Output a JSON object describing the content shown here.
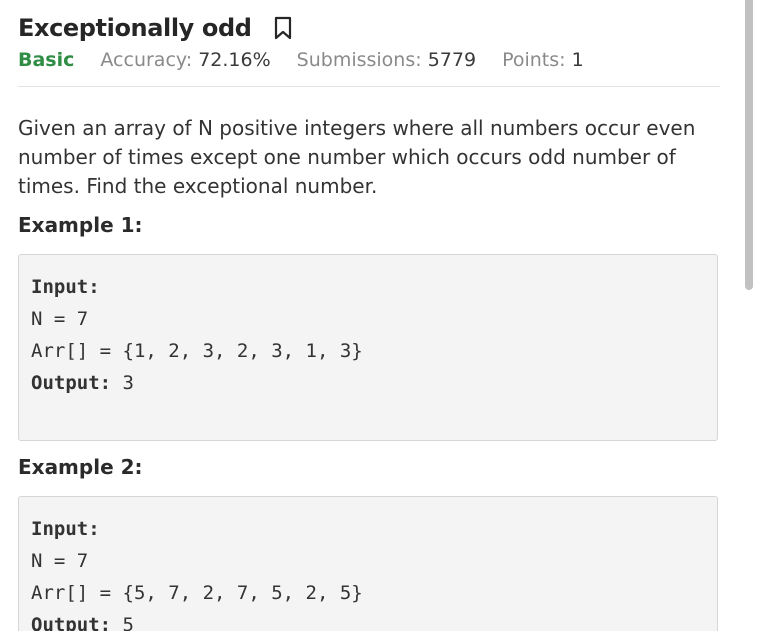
{
  "problem": {
    "title": "Exceptionally odd",
    "difficulty": "Basic",
    "accuracy_label": "Accuracy:",
    "accuracy_value": "72.16%",
    "submissions_label": "Submissions:",
    "submissions_value": "5779",
    "points_label": "Points:",
    "points_value": "1",
    "description": "Given an array of N positive integers where all numbers occur even number of times except one number which occurs odd number of times. Find the exceptional number."
  },
  "examples": [
    {
      "heading": "Example 1:",
      "input_label": "Input:",
      "n_line": "N = 7",
      "arr_line": "Arr[] = {1, 2, 3, 2, 3, 1, 3}",
      "output_label": "Output:",
      "output_value": " 3"
    },
    {
      "heading": "Example 2:",
      "input_label": "Input:",
      "n_line": "N = 7",
      "arr_line": "Arr[] = {5, 7, 2, 7, 5, 2, 5}",
      "output_label": "Output:",
      "output_value": " 5"
    }
  ],
  "icons": {
    "bookmark": "bookmark-icon"
  },
  "colors": {
    "difficulty": "#2f8d46",
    "code_background": "#f4f4f4"
  }
}
